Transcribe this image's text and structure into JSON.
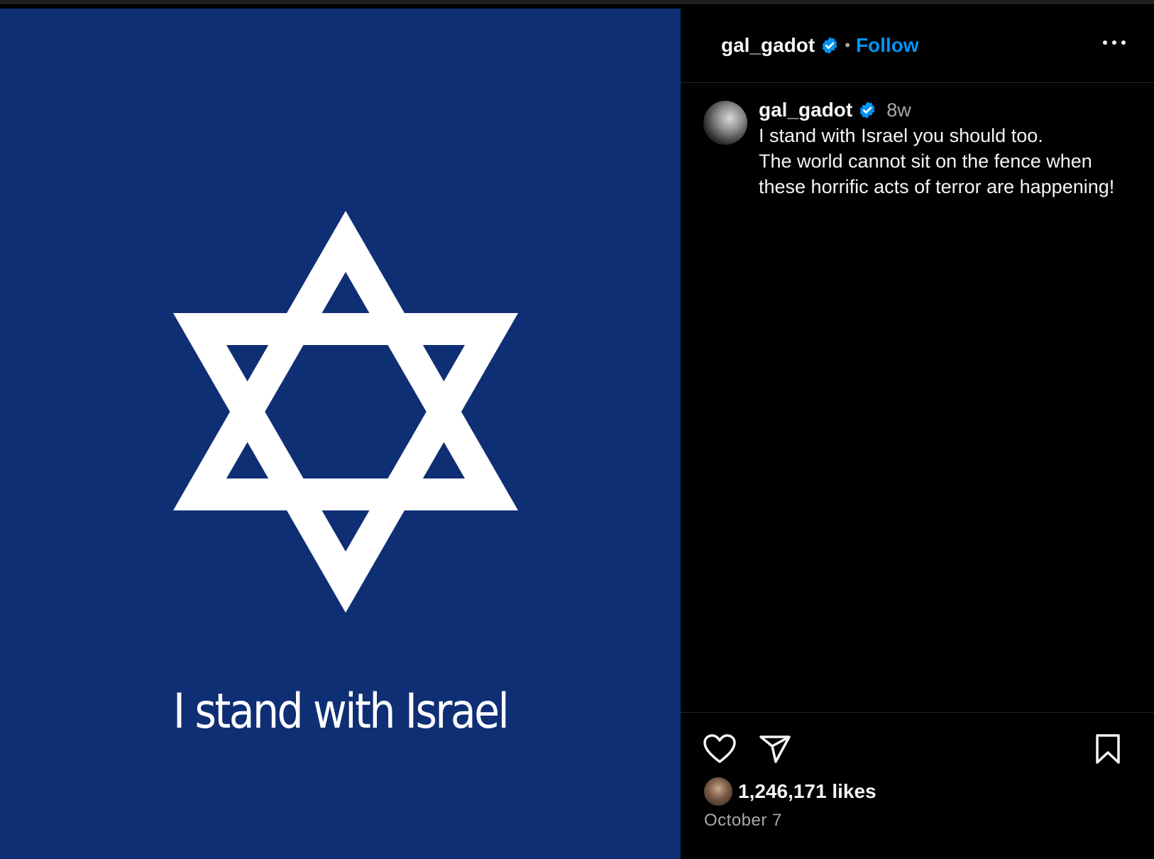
{
  "colors": {
    "media_background": "#0f2f75",
    "follow_blue": "#0095f6",
    "verified_blue": "#0095f6",
    "panel_background": "#000000",
    "muted_text": "#a8a8a8"
  },
  "media": {
    "image_caption": "I stand with Israel",
    "symbol": "star-of-david-icon"
  },
  "header": {
    "username": "gal_gadot",
    "separator": "•",
    "follow_label": "Follow"
  },
  "post_caption": {
    "username": "gal_gadot",
    "time_ago": "8w",
    "text": "I stand with Israel you should too.\nThe world cannot sit on the fence when these horrific acts of terror are happening!"
  },
  "actions": {
    "like_icon": "heart-icon",
    "share_icon": "paper-plane-icon",
    "save_icon": "bookmark-icon"
  },
  "stats": {
    "likes": "1,246,171 likes",
    "date": "October 7"
  }
}
